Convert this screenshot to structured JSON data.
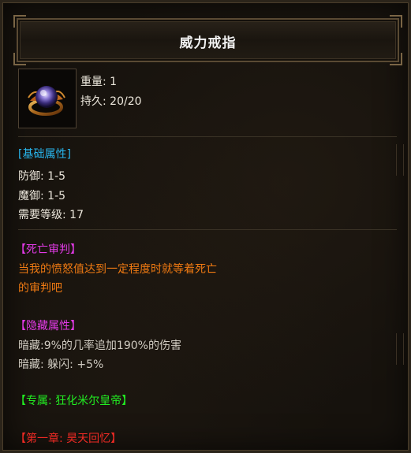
{
  "item": {
    "name": "威力戒指",
    "icon": "ring-icon",
    "weight": "重量: 1",
    "durability": "持久: 20/20"
  },
  "basic": {
    "header": "[基础属性]",
    "defense": "防御: 1-5",
    "magic_defense": "魔御: 1-5",
    "required_level": "需要等级: 17"
  },
  "judgment": {
    "header": "【死亡审判】",
    "line1": "当我的愤怒值达到一定程度时就等着死亡",
    "line2": "的审判吧"
  },
  "hidden": {
    "header": "【隐藏属性】",
    "line1": "暗藏:9%的几率追加190%的伤害",
    "line2": "暗藏: 躲闪: +5%"
  },
  "exclusive": "【专属: 狂化米尔皇帝】",
  "chapter": "【第一章: 昊天回忆】",
  "colors": {
    "blue": "#28b6ee",
    "magenta": "#e23ae6",
    "orange": "#f07a12",
    "green": "#22ee22",
    "red": "#ee2a24"
  }
}
